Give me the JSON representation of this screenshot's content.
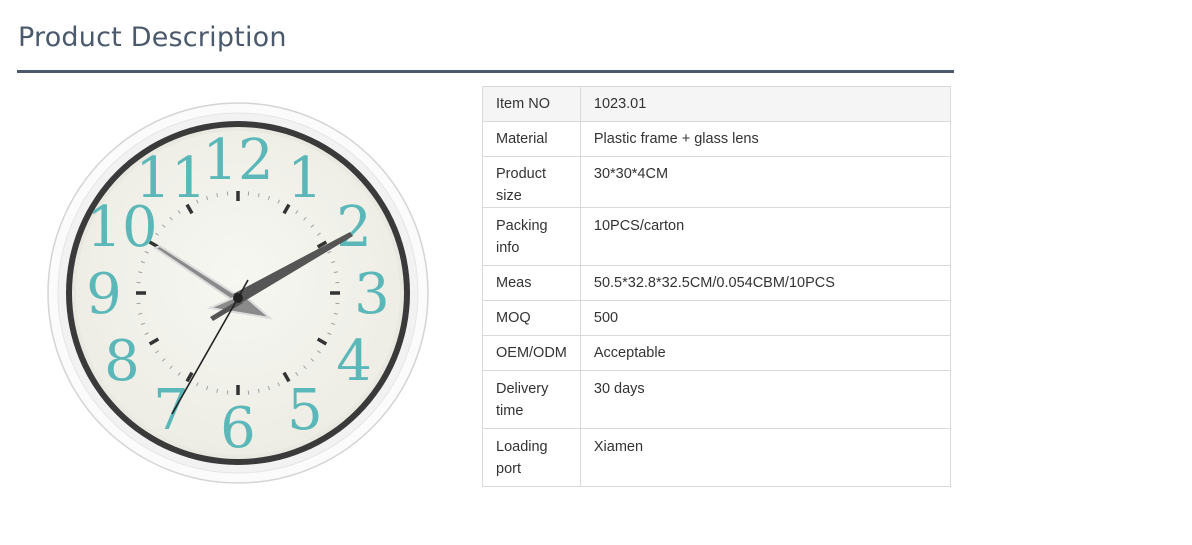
{
  "page": {
    "title": "Product Description"
  },
  "product_image": {
    "subject": "clock-image",
    "numerals": [
      "12",
      "1",
      "2",
      "3",
      "4",
      "5",
      "6",
      "7",
      "8",
      "9",
      "10",
      "11"
    ],
    "colors": {
      "numerals": "#5cb8b8",
      "frame": "#f7f7f7",
      "bezel": "#333333",
      "dial": "#f2f2ea",
      "hands": "#555555"
    }
  },
  "specs": [
    {
      "label": "Item NO",
      "value": "1023.01"
    },
    {
      "label": "Material",
      "value": "Plastic frame + glass lens"
    },
    {
      "label": "Product size",
      "value": "30*30*4CM"
    },
    {
      "label": "Packing info",
      "value": "10PCS/carton"
    },
    {
      "label": "Meas",
      "value": "50.5*32.8*32.5CM/0.054CBM/10PCS"
    },
    {
      "label": "MOQ",
      "value": "500"
    },
    {
      "label": "OEM/ODM",
      "value": "Acceptable"
    },
    {
      "label": "Delivery time",
      "value": "30 days"
    },
    {
      "label": "Loading port",
      "value": "Xiamen"
    }
  ]
}
